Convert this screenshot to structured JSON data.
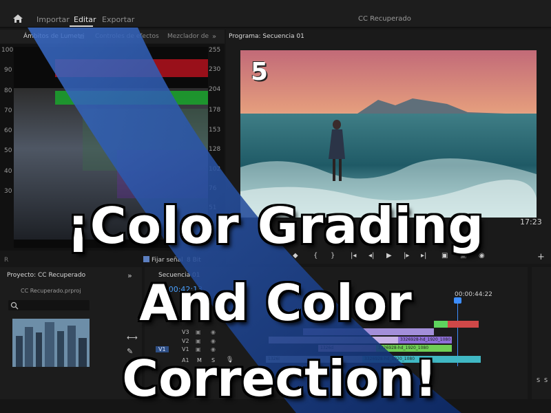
{
  "topbar": {
    "nav": [
      "Importar",
      "Editar",
      "Exportar"
    ],
    "active": "Editar",
    "title": "CC Recuperado"
  },
  "left_panel": {
    "tabs": [
      "Ámbitos de Lumetri",
      "Controles de efectos",
      "Mezclador de"
    ],
    "scale_left": [
      "100",
      "90",
      "80",
      "70",
      "60",
      "50",
      "40",
      "30"
    ],
    "scale_right": [
      "255",
      "230",
      "204",
      "178",
      "153",
      "128",
      "102",
      "76",
      "51"
    ],
    "fijar_label": "Fijar señal",
    "bit_label": "8 Bit"
  },
  "program": {
    "tab": "Programa: Secuencia 01",
    "step_number": "5",
    "timecode_partial": "17:23"
  },
  "project": {
    "tab": "Proyecto: CC Recuperado",
    "file": "CC Recuperado.prproj"
  },
  "timeline": {
    "tab": "Secuencia 01",
    "timecode": "00:00:42:13",
    "ruler_time": "00:00:44:22",
    "tracks": [
      "V3",
      "V2",
      "V1",
      "A1"
    ],
    "source_patch": "V1",
    "clips": [
      {
        "track": "V2",
        "label": "3326928-hd_1920_1080",
        "color": "#8f6fd9"
      },
      {
        "track": "V1",
        "label": "1326d",
        "color": "#d9a0cf"
      },
      {
        "track": "V1",
        "label": "3326928-hd_1920_1080",
        "color": "#6fcf55"
      },
      {
        "track": "A1",
        "label": "1326l",
        "color": "#9fb7d8"
      },
      {
        "track": "A1",
        "label": "3326928-hd_1920_1080",
        "color": "#40b8c4"
      }
    ]
  },
  "meter_labels": [
    "S",
    "S"
  ],
  "headline": {
    "line1": "¡Color Grading",
    "line2": "And Color",
    "line3": "Correction!"
  },
  "colors": {
    "accent_blue": "#3d8eff",
    "overlay_blue": "#1e4fa8",
    "panel_bg": "#1b1b1b"
  }
}
